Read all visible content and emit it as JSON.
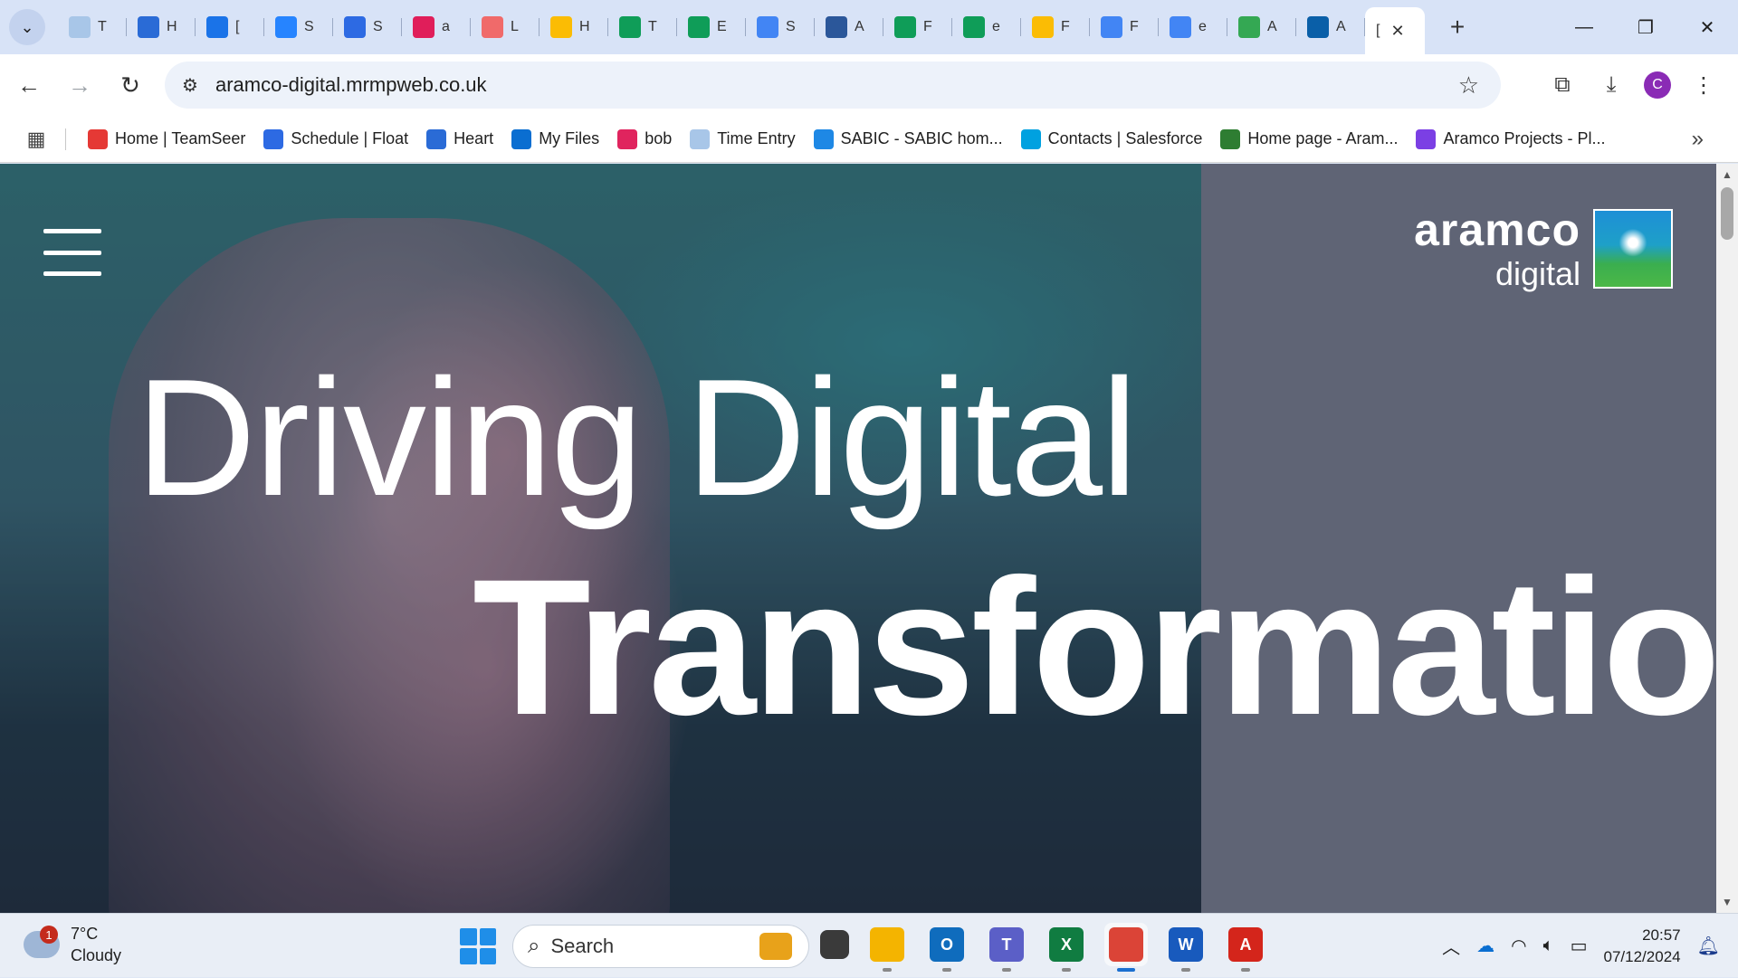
{
  "browser": {
    "tab_menu_icon": "chevron-down",
    "tabs": [
      {
        "label": "T",
        "icon_color": "#a8c6e8"
      },
      {
        "label": "H",
        "icon_color": "#2a6bd6"
      },
      {
        "label": "[",
        "icon_color": "#1a73e8"
      },
      {
        "label": "S",
        "icon_color": "#2684ff"
      },
      {
        "label": "S",
        "icon_color": "#2d6ae3"
      },
      {
        "label": "a",
        "icon_color": "#e01e5a"
      },
      {
        "label": "L",
        "icon_color": "#f06a6a"
      },
      {
        "label": "H",
        "icon_color": "#fbbc04"
      },
      {
        "label": "T",
        "icon_color": "#0f9d58"
      },
      {
        "label": "E",
        "icon_color": "#0f9d58"
      },
      {
        "label": "S",
        "icon_color": "#4285f4"
      },
      {
        "label": "A",
        "icon_color": "#2b579a"
      },
      {
        "label": "F",
        "icon_color": "#0f9d58"
      },
      {
        "label": "e",
        "icon_color": "#0f9d58"
      },
      {
        "label": "F",
        "icon_color": "#fbbc04"
      },
      {
        "label": "F",
        "icon_color": "#4285f4"
      },
      {
        "label": "e",
        "icon_color": "#4285f4"
      },
      {
        "label": "A",
        "icon_color": "#34a853"
      },
      {
        "label": "A",
        "icon_color": "#0a5fa8"
      }
    ],
    "active_tab": {
      "label": "[",
      "close": "✕"
    },
    "new_tab": "+",
    "window_controls": {
      "minimize": "—",
      "restore": "❐",
      "close": "✕"
    },
    "url": "aramco-digital.mrmpweb.co.uk",
    "avatar_letter": "C"
  },
  "bookmarks": [
    {
      "label": "Home | TeamSeer",
      "icon_color": "#e53935"
    },
    {
      "label": "Schedule | Float",
      "icon_color": "#2d6ae3"
    },
    {
      "label": "Heart",
      "icon_color": "#2a6bd6"
    },
    {
      "label": "My Files",
      "icon_color": "#0a6ed1"
    },
    {
      "label": "bob",
      "icon_color": "#e0245e"
    },
    {
      "label": "Time Entry",
      "icon_color": "#a8c6e8"
    },
    {
      "label": "SABIC - SABIC hom...",
      "icon_color": "#1e88e5"
    },
    {
      "label": "Contacts | Salesforce",
      "icon_color": "#00a1e0"
    },
    {
      "label": "Home page - Aram...",
      "icon_color": "#2e7d32"
    },
    {
      "label": "Aramco Projects - Pl...",
      "icon_color": "#7b3fe4"
    }
  ],
  "page": {
    "logo_line1": "aramco",
    "logo_line2": "digital",
    "headline_line1": "Driving Digital",
    "headline_line2": "Transformation"
  },
  "taskbar": {
    "weather_temp": "7°C",
    "weather_desc": "Cloudy",
    "weather_badge": "1",
    "search_label": "Search",
    "apps": [
      {
        "name": "file-explorer",
        "label": "",
        "color": "#f4b400",
        "active": false
      },
      {
        "name": "outlook",
        "label": "O",
        "color": "#0f6cbd",
        "active": false
      },
      {
        "name": "teams",
        "label": "T",
        "color": "#5b5fc7",
        "active": false
      },
      {
        "name": "excel",
        "label": "X",
        "color": "#107c41",
        "active": false
      },
      {
        "name": "chrome",
        "label": "",
        "color": "#db4437",
        "active": true
      },
      {
        "name": "word",
        "label": "W",
        "color": "#185abd",
        "active": false
      },
      {
        "name": "acrobat",
        "label": "A",
        "color": "#d4251b",
        "active": false
      }
    ],
    "time": "20:57",
    "date": "07/12/2024"
  }
}
